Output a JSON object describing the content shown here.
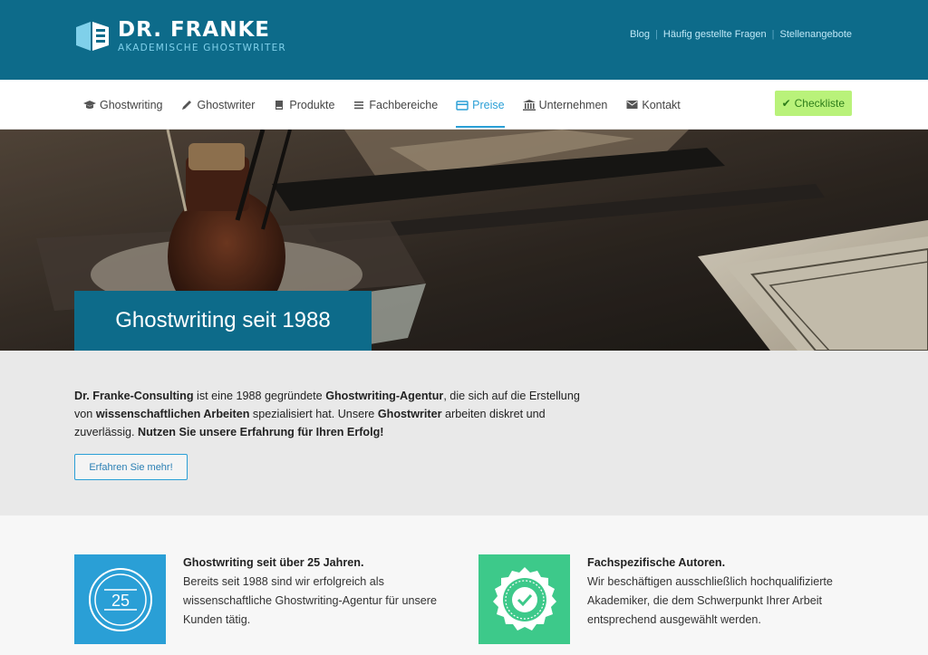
{
  "header": {
    "logo_title": "DR. FRANKE",
    "logo_subtitle": "AKADEMISCHE GHOSTWRITER",
    "top_links": [
      "Blog",
      "Häufig gestellte Fragen",
      "Stellenangebote"
    ]
  },
  "nav": {
    "items": [
      {
        "label": "Ghostwriting",
        "icon": "graduation-cap-icon"
      },
      {
        "label": "Ghostwriter",
        "icon": "pencil-icon"
      },
      {
        "label": "Produkte",
        "icon": "book-icon"
      },
      {
        "label": "Fachbereiche",
        "icon": "list-icon"
      },
      {
        "label": "Preise",
        "icon": "credit-card-icon"
      },
      {
        "label": "Unternehmen",
        "icon": "institution-icon"
      },
      {
        "label": "Kontakt",
        "icon": "envelope-icon"
      }
    ],
    "active": "Preise",
    "checklist_label": "Checkliste"
  },
  "hero": {
    "title": "Ghostwriting seit 1988"
  },
  "intro": {
    "p1_bold1": "Dr. Franke-Consulting",
    "p1_t1": " ist eine 1988 gegründete ",
    "p1_bold2": "Ghostwriting-Agentur",
    "p1_t2": ", die sich auf die Erstellung von ",
    "p1_bold3": "wissenschaftlichen Arbeiten",
    "p1_t3": " spezialisiert hat. Unsere ",
    "p1_bold4": "Ghostwriter",
    "p1_t4": " arbeiten diskret und zuverlässig. ",
    "p1_bold5": "Nutzen Sie unsere Erfahrung für Ihren Erfolg!",
    "button": "Erfahren Sie mehr!"
  },
  "features": [
    {
      "title": "Ghostwriting seit über 25 Jahren.",
      "text": "Bereits seit 1988 sind wir erfolgreich als wissenschaftliche Ghostwriting-Agentur für unsere Kunden tätig.",
      "badge_number": "25",
      "color": "#2a9fd6"
    },
    {
      "title": "Fachspezifische Autoren.",
      "text": "Wir beschäftigen ausschließlich hochqualifizierte Akademiker, die dem Schwerpunkt Ihrer Arbeit entsprechend ausgewählt werden.",
      "color": "#3dc98a"
    }
  ],
  "colors": {
    "brand": "#0d6b8a",
    "accent": "#2a9fd6",
    "checklist": "#b9f27a"
  }
}
